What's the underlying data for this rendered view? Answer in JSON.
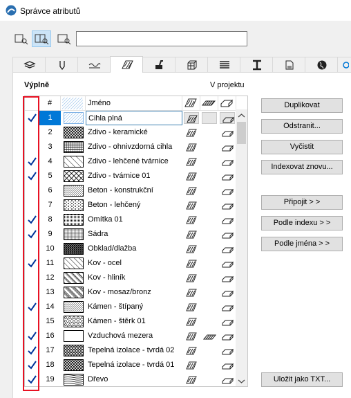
{
  "window": {
    "title": "Správce atributů"
  },
  "search": {
    "value": ""
  },
  "view_buttons": [
    {
      "icon": "list-view-icon",
      "active": false
    },
    {
      "icon": "split-view-icon",
      "active": true
    },
    {
      "icon": "detail-view-icon",
      "active": false
    }
  ],
  "tabs": [
    {
      "icon": "layers-icon",
      "active": false
    },
    {
      "icon": "pens-icon",
      "active": false
    },
    {
      "icon": "line-types-icon",
      "active": false
    },
    {
      "icon": "fills-icon",
      "active": true
    },
    {
      "icon": "surfaces-icon",
      "active": false
    },
    {
      "icon": "building-materials-icon",
      "active": false
    },
    {
      "icon": "composites-icon",
      "active": false
    },
    {
      "icon": "profiles-icon",
      "active": false
    },
    {
      "icon": "zone-categories-icon",
      "active": false
    },
    {
      "icon": "globe-icon",
      "active": false
    }
  ],
  "section": {
    "label": "Výplně",
    "in_project": "V projektu"
  },
  "table": {
    "header": {
      "num": "#",
      "name": "Jméno"
    },
    "rows": [
      {
        "num": "1",
        "name": "Cihla plná",
        "checked": true,
        "pattern": "diag-blue",
        "selected": true
      },
      {
        "num": "2",
        "name": "Zdivo - keramické",
        "checked": false,
        "pattern": "crosshatch"
      },
      {
        "num": "3",
        "name": "Zdivo - ohnivzdorná cihla",
        "checked": false,
        "pattern": "crosshatch-v"
      },
      {
        "num": "4",
        "name": "Zdivo - lehčené tvárnice",
        "checked": true,
        "pattern": "diag-wide"
      },
      {
        "num": "5",
        "name": "Zdivo - tvárnice 01",
        "checked": true,
        "pattern": "xcross"
      },
      {
        "num": "6",
        "name": "Beton - konstrukční",
        "checked": false,
        "pattern": "dots"
      },
      {
        "num": "7",
        "name": "Beton - lehčený",
        "checked": false,
        "pattern": "dots-sparse"
      },
      {
        "num": "8",
        "name": "Omítka 01",
        "checked": true,
        "pattern": "fine-dots"
      },
      {
        "num": "9",
        "name": "Sádra",
        "checked": true,
        "pattern": "grid-fine"
      },
      {
        "num": "10",
        "name": "Obklad/dlažba",
        "checked": false,
        "pattern": "checker"
      },
      {
        "num": "11",
        "name": "Kov - ocel",
        "checked": true,
        "pattern": "diag-thin"
      },
      {
        "num": "12",
        "name": "Kov - hliník",
        "checked": false,
        "pattern": "diag-double"
      },
      {
        "num": "13",
        "name": "Kov - mosaz/bronz",
        "checked": false,
        "pattern": "diag-triple"
      },
      {
        "num": "14",
        "name": "Kámen - štípaný",
        "checked": true,
        "pattern": "dots"
      },
      {
        "num": "15",
        "name": "Kámen - štěrk 01",
        "checked": false,
        "pattern": "gravel"
      },
      {
        "num": "16",
        "name": "Vzduchová mezera",
        "checked": true,
        "pattern": "empty"
      },
      {
        "num": "17",
        "name": "Tepelná izolace - tvrdá 02",
        "checked": true,
        "pattern": "insulation"
      },
      {
        "num": "18",
        "name": "Tepelná izolace - tvrdá 01",
        "checked": true,
        "pattern": "insulation2"
      },
      {
        "num": "19",
        "name": "Dřevo",
        "checked": true,
        "pattern": "wood"
      }
    ]
  },
  "buttons": {
    "duplicate": "Duplikovat",
    "remove": "Odstranit...",
    "clean": "Vyčistit",
    "reindex": "Indexovat znovu...",
    "attach": "Připojit > >",
    "by_index": "Podle indexu > >",
    "by_name": "Podle jména > >",
    "save_txt": "Uložit jako TXT..."
  },
  "colors": {
    "selection": "#0078d7",
    "highlight": "#e81123",
    "check": "#003399"
  }
}
